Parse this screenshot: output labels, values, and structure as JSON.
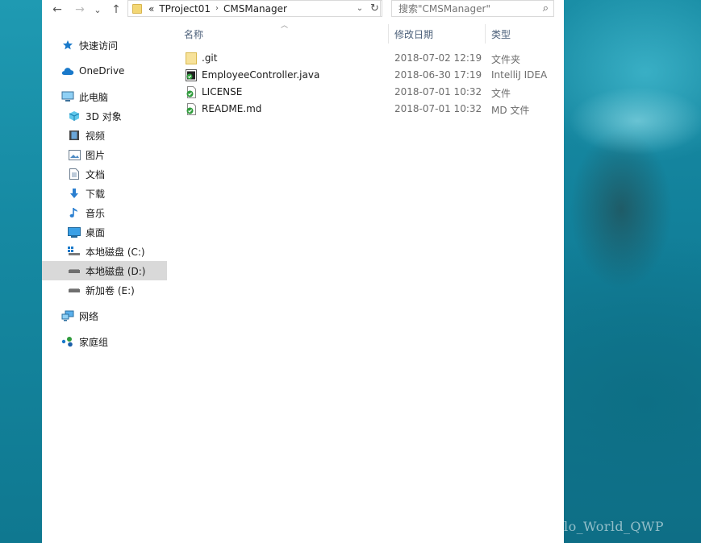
{
  "toolbar": {
    "back_icon": "←",
    "forward_icon": "→",
    "recent_icon": "⌄",
    "up_icon": "↑"
  },
  "address": {
    "overflow": "«",
    "crumbs": [
      "TProject01",
      "CMSManager"
    ],
    "separator": "›",
    "dropdown_icon": "⌄",
    "refresh_icon": "↻"
  },
  "search": {
    "placeholder": "搜索\"CMSManager\"",
    "icon": "⌕"
  },
  "sidebar": {
    "items": [
      {
        "label": "快速访问",
        "icon": "star-icon"
      },
      {
        "label": "OneDrive",
        "icon": "cloud-icon"
      },
      {
        "label": "此电脑",
        "icon": "computer-icon"
      },
      {
        "label": "3D 对象",
        "icon": "cube-icon"
      },
      {
        "label": "视频",
        "icon": "video-icon"
      },
      {
        "label": "图片",
        "icon": "picture-icon"
      },
      {
        "label": "文档",
        "icon": "document-icon"
      },
      {
        "label": "下载",
        "icon": "download-icon"
      },
      {
        "label": "音乐",
        "icon": "music-icon"
      },
      {
        "label": "桌面",
        "icon": "desktop-icon"
      },
      {
        "label": "本地磁盘 (C:)",
        "icon": "drive-c-icon"
      },
      {
        "label": "本地磁盘 (D:)",
        "icon": "drive-icon",
        "selected": true
      },
      {
        "label": "新加卷 (E:)",
        "icon": "drive-icon"
      },
      {
        "label": "网络",
        "icon": "network-icon"
      },
      {
        "label": "家庭组",
        "icon": "homegroup-icon"
      }
    ]
  },
  "columns": {
    "name": "名称",
    "modified": "修改日期",
    "type": "类型"
  },
  "files": [
    {
      "name": ".git",
      "modified": "2018-07-02 12:19",
      "type": "文件夹",
      "icon": "folder-icon"
    },
    {
      "name": "EmployeeController.java",
      "modified": "2018-06-30 17:19",
      "type": "IntelliJ IDEA",
      "icon": "java-file-icon"
    },
    {
      "name": "LICENSE",
      "modified": "2018-07-01 10:32",
      "type": "文件",
      "icon": "file-check-icon"
    },
    {
      "name": "README.md",
      "modified": "2018-07-01 10:32",
      "type": "MD 文件",
      "icon": "file-check-icon"
    }
  ],
  "watermark": "https://blog.csdn.net/Hello_World_QWP",
  "colors": {
    "column_header": "#4c607a",
    "selection": "#d9d9d9",
    "accent_blue": "#1979ca",
    "check_green": "#2e9b3a",
    "folder_yellow": "#f3d775"
  }
}
